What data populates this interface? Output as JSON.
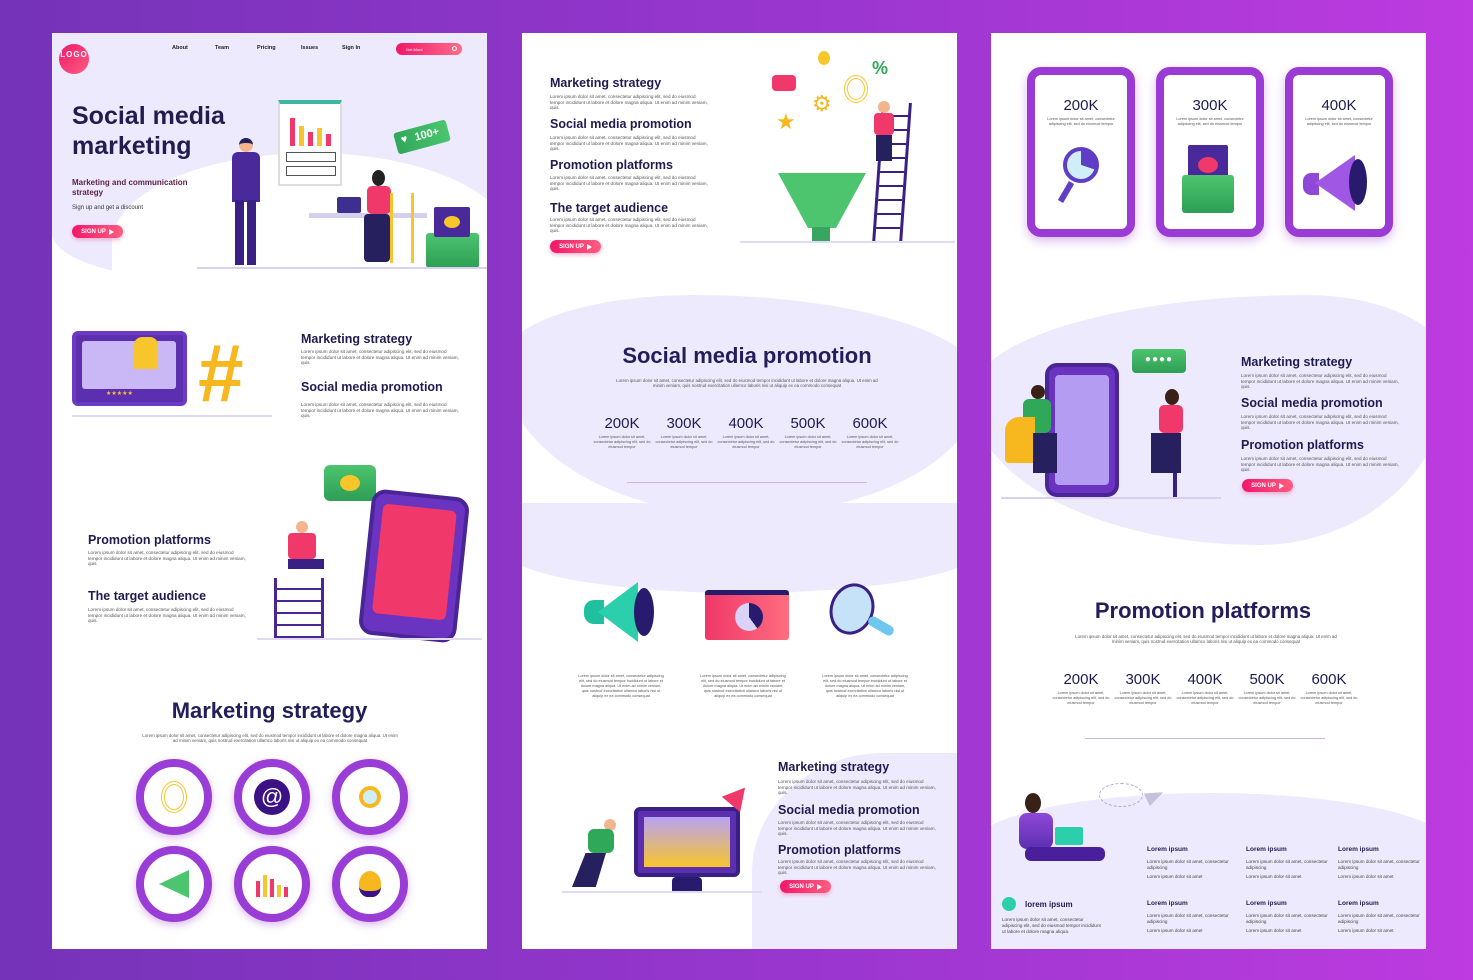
{
  "lorem_short": "Lorem ipsum dolor sit amet, consectetur adipiscing elit, sed do eiusmod tempor incididunt ut labore et dolore magna aliqua. Ut enim ad minim veniam, quis.",
  "lorem_long": "Lorem ipsum dolor sit amet, consectetur adipiscing elit, sed do eiusmod tempor incididunt ut labore et dolore magna aliqua. Ut enim ad minim veniam, quis nostrud exercitation ullamco laboris nisi ut aliquip ex ea commodo consequat",
  "lorem_stat": "Lorem ipsum dolor sit amet, consectetur adipiscing elit, sed do eiusmod tempor",
  "lorem_feature": "Lorem ipsum dolor sit amet, consectetur adipiscing elit, sed do eiusmod tempor incididunt ut labore et dolore magna aliqua. Ut enim ad minim veniam, quis nostrud exercitation ullamco laboris nisi ut aliquip ex ea commodo consequat",
  "colors": {
    "accent": "#f0186a",
    "purple": "#9a3cd6",
    "navy": "#1d1b4f",
    "lavender": "#eeeafd"
  },
  "panel1": {
    "logo": "LOGO",
    "nav": [
      "About",
      "Team",
      "Pricing",
      "Issues",
      "Sign In"
    ],
    "search_placeholder": "Get More",
    "hero_title_1": "Social media",
    "hero_title_2": "marketing",
    "hero_subtitle": "Marketing and communication strategy",
    "hero_tagline": "Sign up and get a discount",
    "signup": "SIGN UP",
    "badge": "100+",
    "sections": [
      "Marketing strategy",
      "Social media promotion",
      "Promotion platforms",
      "The target audience"
    ],
    "strategy_title": "Marketing strategy",
    "icons": [
      "target-icon",
      "at-sign-icon",
      "magnifier-icon",
      "megaphone-icon",
      "chart-icon",
      "lightbulb-icon"
    ]
  },
  "panel2": {
    "sections": [
      "Marketing strategy",
      "Social media promotion",
      "Promotion platforms",
      "The target audience"
    ],
    "signup": "SIGN UP",
    "promo_title": "Social media promotion",
    "stats": [
      "200K",
      "300K",
      "400K",
      "500K",
      "600K"
    ],
    "features": [
      "megaphone-icon",
      "dashboard-window-icon",
      "magnifier-icon"
    ],
    "bottom_sections": [
      "Marketing strategy",
      "Social media promotion",
      "Promotion platforms"
    ],
    "signup2": "SIGN UP"
  },
  "panel3": {
    "cards": [
      {
        "value": "200K",
        "icon": "magnifier-chart-icon"
      },
      {
        "value": "300K",
        "icon": "video-folder-icon"
      },
      {
        "value": "400K",
        "icon": "megaphone-icon"
      }
    ],
    "sections": [
      "Marketing strategy",
      "Social media promotion",
      "Promotion platforms"
    ],
    "signup": "SIGN UP",
    "platforms_title": "Promotion platforms",
    "stats": [
      "200K",
      "300K",
      "400K",
      "500K",
      "600K"
    ],
    "footer": {
      "brand": "lorem ipsum",
      "brand_text": "Lorem ipsum dolor sit amet, consectetur adipiscing elit, sed do eiusmod tempor incididunt ut labore et dolore magna aliqua.",
      "col_title": "Lorem ipsum",
      "line1": "Lorem ipsum dolor sit amet, consectetur adipiscing",
      "line2": "Lorem ipsum dolor sit amet"
    }
  }
}
